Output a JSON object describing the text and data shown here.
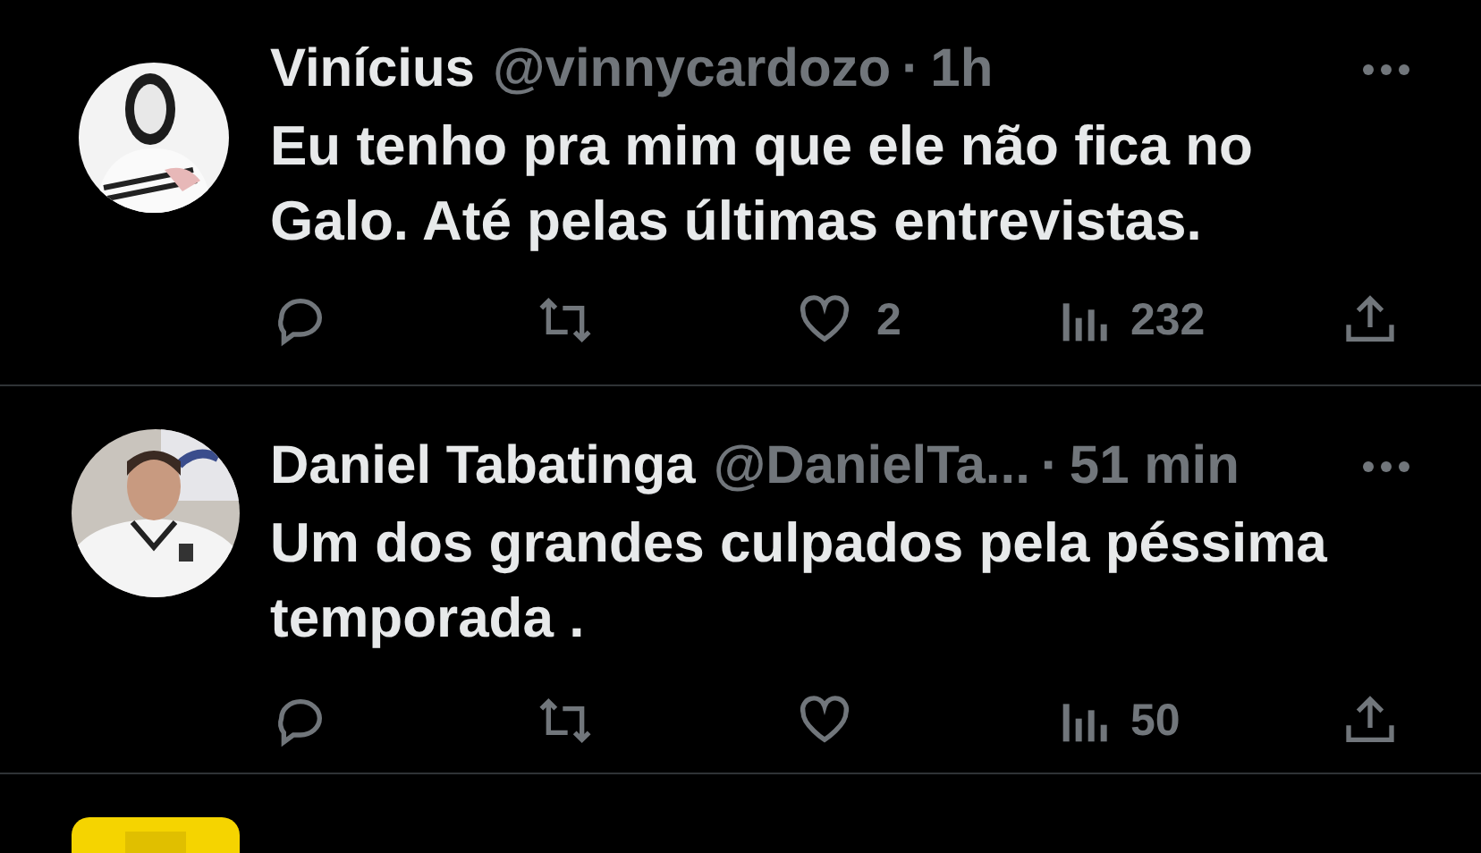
{
  "tweets": [
    {
      "name": "Vinícius",
      "handle": "@vinnycardozo",
      "separator": "·",
      "time": "1h",
      "text": "Eu tenho pra mim que ele não fica no Galo. Até pelas últimas entrevistas.",
      "actions": [
        {
          "kind": "reply"
        },
        {
          "kind": "repost"
        },
        {
          "kind": "like",
          "count": "2"
        },
        {
          "kind": "views",
          "count": "232"
        },
        {
          "kind": "share"
        }
      ]
    },
    {
      "name": "Daniel Tabatinga",
      "handle": "@DanielTa...",
      "separator": "·",
      "time": "51 min",
      "text": "Um dos grandes culpados pela péssima temporada .",
      "actions": [
        {
          "kind": "reply"
        },
        {
          "kind": "repost"
        },
        {
          "kind": "like"
        },
        {
          "kind": "views",
          "count": "50"
        },
        {
          "kind": "share"
        }
      ]
    }
  ]
}
